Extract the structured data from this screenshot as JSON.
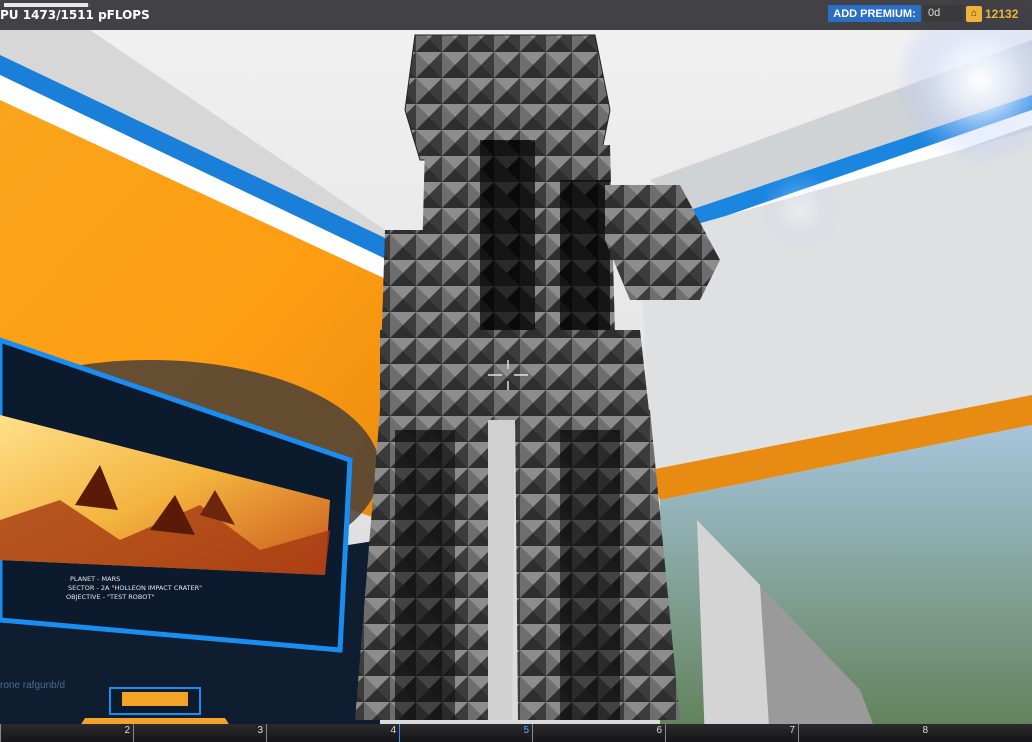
{
  "hud": {
    "cpu_label": "PU 1473/1511 pFLOPS",
    "cpu_fraction": 0.975,
    "premium_label": "ADD PREMIUM:",
    "premium_days": "0d",
    "currency_value": "12132",
    "currency_icon": "robit-icon"
  },
  "monitor": {
    "line1": "PLANET - MARS",
    "line2": "SECTOR - 2A \"HOLLEON IMPACT CRATER\"",
    "line3": "OBJECTIVE - \"TEST ROBOT\""
  },
  "hotbar": {
    "slots": [
      "2",
      "3",
      "4",
      "5",
      "6",
      "7",
      "8"
    ],
    "selected_index": 3
  },
  "link_text": "rone rafgunb/d",
  "colors": {
    "accent_blue": "#2a6fc4",
    "currency_gold": "#f0b23a",
    "wall_orange": "#f5a623"
  }
}
